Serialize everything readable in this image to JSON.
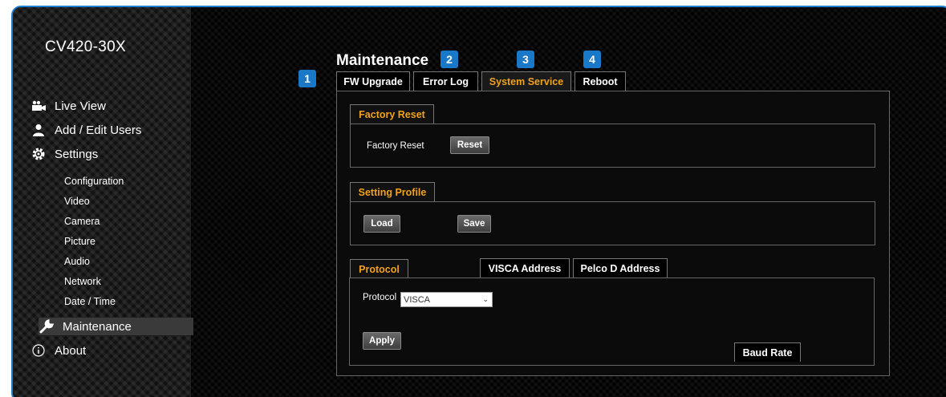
{
  "sidebar": {
    "model": "CV420-30X",
    "main_items": [
      {
        "label": "Live View",
        "icon": "camera-icon"
      },
      {
        "label": "Add / Edit Users",
        "icon": "user-icon"
      },
      {
        "label": "Settings",
        "icon": "gear-icon"
      }
    ],
    "settings_items": [
      "Configuration",
      "Video",
      "Camera",
      "Picture",
      "Audio",
      "Network",
      "Date / Time"
    ],
    "maintenance": {
      "label": "Maintenance",
      "icon": "wrench-icon"
    },
    "about": {
      "label": "About",
      "icon": "info-icon"
    }
  },
  "badges": [
    "1",
    "2",
    "3",
    "4"
  ],
  "page_title": "Maintenance",
  "tabs": [
    "FW Upgrade",
    "Error Log",
    "System Service",
    "Reboot"
  ],
  "active_tab": "System Service",
  "factory_reset": {
    "section": "Factory Reset",
    "label": "Factory Reset",
    "button": "Reset"
  },
  "setting_profile": {
    "section": "Setting Profile",
    "load": "Load",
    "save": "Save"
  },
  "protocol_tabs": [
    "Protocol",
    "Baud Rate",
    "VISCA Address",
    "Pelco D Address"
  ],
  "protocol": {
    "label": "Protocol",
    "value": "VISCA",
    "apply": "Apply"
  },
  "colors": {
    "accent": "#f0a21e",
    "badge": "#1a78c8",
    "border": "#1e7fd0"
  }
}
